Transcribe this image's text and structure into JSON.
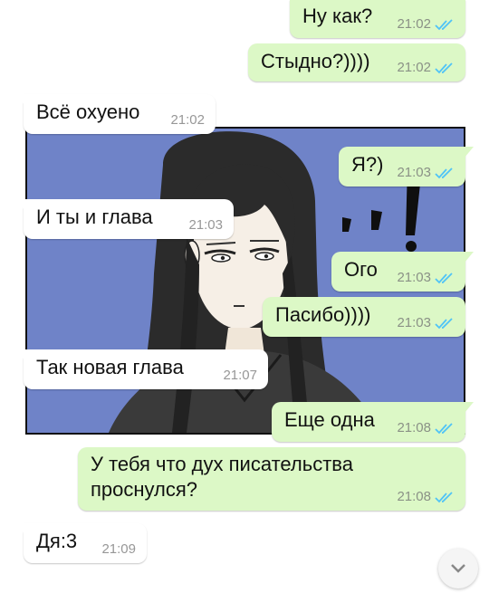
{
  "accent_colors": {
    "outgoing_bubble": "#dcf8c6",
    "incoming_bubble": "#ffffff",
    "read_ticks": "#4fc3f7",
    "sticker_background": "#6f83c8"
  },
  "messages": [
    {
      "direction": "out",
      "text": "Ну как?",
      "time": "21:02",
      "status": "read"
    },
    {
      "direction": "out",
      "text": "Стыдно?))))",
      "time": "21:02",
      "status": "read"
    },
    {
      "direction": "in",
      "text": "Всё охуено",
      "time": "21:02"
    },
    {
      "direction": "out",
      "text": "Я?)",
      "time": "21:03",
      "status": "read"
    },
    {
      "direction": "in",
      "text": "И ты и глава",
      "time": "21:03"
    },
    {
      "direction": "out",
      "text": "Ого",
      "time": "21:03",
      "status": "read"
    },
    {
      "direction": "out",
      "text": "Пасибо))))",
      "time": "21:03",
      "status": "read"
    },
    {
      "direction": "in",
      "text": "Так новая глава",
      "time": "21:07"
    },
    {
      "direction": "out",
      "text": "Еще одна",
      "time": "21:08",
      "status": "read"
    },
    {
      "direction": "out",
      "text": "У тебя что дух писательства\nпроснулся?",
      "time": "21:08",
      "status": "read"
    },
    {
      "direction": "in",
      "text": "Дя:3",
      "time": "21:09"
    }
  ],
  "background_image": {
    "icon": "comic-character-sticker"
  },
  "scroll_button": {
    "icon": "chevron-down-icon"
  }
}
